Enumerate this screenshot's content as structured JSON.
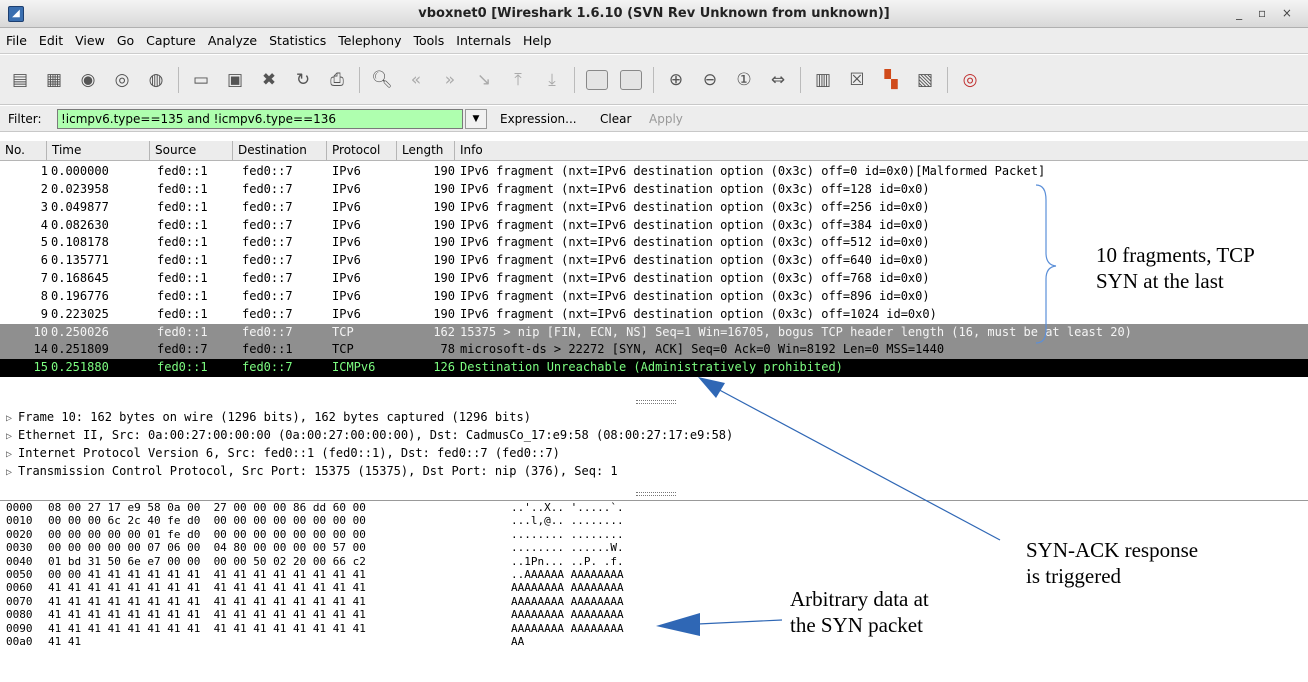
{
  "window": {
    "title": "vboxnet0   [Wireshark 1.6.10  (SVN Rev Unknown from unknown)]",
    "controls": "_ ▫ ×"
  },
  "menu": [
    "File",
    "Edit",
    "View",
    "Go",
    "Capture",
    "Analyze",
    "Statistics",
    "Telephony",
    "Tools",
    "Internals",
    "Help"
  ],
  "filter": {
    "label": "Filter:",
    "value": "!icmpv6.type==135 and !icmpv6.type==136",
    "expression": "Expression...",
    "clear": "Clear",
    "apply": "Apply",
    "valid_color": "#afffaf"
  },
  "columns": [
    "No.",
    "Time",
    "Source",
    "Destination",
    "Protocol",
    "Length",
    "Info"
  ],
  "packets": [
    {
      "no": "1",
      "time": "0.000000",
      "src": "fed0::1",
      "dst": "fed0::7",
      "proto": "IPv6",
      "len": "190",
      "info": "IPv6 fragment (nxt=IPv6 destination option (0x3c) off=0 id=0x0)[Malformed Packet]"
    },
    {
      "no": "2",
      "time": "0.023958",
      "src": "fed0::1",
      "dst": "fed0::7",
      "proto": "IPv6",
      "len": "190",
      "info": "IPv6 fragment (nxt=IPv6 destination option (0x3c) off=128 id=0x0)"
    },
    {
      "no": "3",
      "time": "0.049877",
      "src": "fed0::1",
      "dst": "fed0::7",
      "proto": "IPv6",
      "len": "190",
      "info": "IPv6 fragment (nxt=IPv6 destination option (0x3c) off=256 id=0x0)"
    },
    {
      "no": "4",
      "time": "0.082630",
      "src": "fed0::1",
      "dst": "fed0::7",
      "proto": "IPv6",
      "len": "190",
      "info": "IPv6 fragment (nxt=IPv6 destination option (0x3c) off=384 id=0x0)"
    },
    {
      "no": "5",
      "time": "0.108178",
      "src": "fed0::1",
      "dst": "fed0::7",
      "proto": "IPv6",
      "len": "190",
      "info": "IPv6 fragment (nxt=IPv6 destination option (0x3c) off=512 id=0x0)"
    },
    {
      "no": "6",
      "time": "0.135771",
      "src": "fed0::1",
      "dst": "fed0::7",
      "proto": "IPv6",
      "len": "190",
      "info": "IPv6 fragment (nxt=IPv6 destination option (0x3c) off=640 id=0x0)"
    },
    {
      "no": "7",
      "time": "0.168645",
      "src": "fed0::1",
      "dst": "fed0::7",
      "proto": "IPv6",
      "len": "190",
      "info": "IPv6 fragment (nxt=IPv6 destination option (0x3c) off=768 id=0x0)"
    },
    {
      "no": "8",
      "time": "0.196776",
      "src": "fed0::1",
      "dst": "fed0::7",
      "proto": "IPv6",
      "len": "190",
      "info": "IPv6 fragment (nxt=IPv6 destination option (0x3c) off=896 id=0x0)"
    },
    {
      "no": "9",
      "time": "0.223025",
      "src": "fed0::1",
      "dst": "fed0::7",
      "proto": "IPv6",
      "len": "190",
      "info": "IPv6 fragment (nxt=IPv6 destination option (0x3c) off=1024 id=0x0)"
    },
    {
      "no": "10",
      "time": "0.250026",
      "src": "fed0::1",
      "dst": "fed0::7",
      "proto": "TCP",
      "len": "162",
      "info": "15375 > nip [FIN, ECN, NS] Seq=1 Win=16705, bogus TCP header length (16, must be at least 20)",
      "style": "gray"
    },
    {
      "no": "14",
      "time": "0.251809",
      "src": "fed0::7",
      "dst": "fed0::1",
      "proto": "TCP",
      "len": "78",
      "info": "microsoft-ds > 22272 [SYN, ACK] Seq=0 Ack=0 Win=8192 Len=0 MSS=1440",
      "style": "gray"
    },
    {
      "no": "15",
      "time": "0.251880",
      "src": "fed0::1",
      "dst": "fed0::7",
      "proto": "ICMPv6",
      "len": "126",
      "info": "Destination Unreachable (Administratively prohibited)",
      "style": "selected"
    }
  ],
  "details": [
    "Frame 10: 162 bytes on wire (1296 bits), 162 bytes captured (1296 bits)",
    "Ethernet II, Src: 0a:00:27:00:00:00 (0a:00:27:00:00:00), Dst: CadmusCo_17:e9:58 (08:00:27:17:e9:58)",
    "Internet Protocol Version 6, Src: fed0::1 (fed0::1), Dst: fed0::7 (fed0::7)",
    "Transmission Control Protocol, Src Port: 15375 (15375), Dst Port: nip (376), Seq: 1"
  ],
  "hex": [
    {
      "off": "0000",
      "bytes": "08 00 27 17 e9 58 0a 00  27 00 00 00 86 dd 60 00",
      "ascii": "..'..X.. '.....`."
    },
    {
      "off": "0010",
      "bytes": "00 00 00 6c 2c 40 fe d0  00 00 00 00 00 00 00 00",
      "ascii": "...l,@.. ........"
    },
    {
      "off": "0020",
      "bytes": "00 00 00 00 00 01 fe d0  00 00 00 00 00 00 00 00",
      "ascii": "........ ........"
    },
    {
      "off": "0030",
      "bytes": "00 00 00 00 00 07 06 00  04 80 00 00 00 00 57 00",
      "ascii": "........ ......W."
    },
    {
      "off": "0040",
      "bytes": "01 bd 31 50 6e e7 00 00  00 00 50 02 20 00 66 c2",
      "ascii": "..1Pn... ..P. .f."
    },
    {
      "off": "0050",
      "bytes": "00 00 41 41 41 41 41 41  41 41 41 41 41 41 41 41",
      "ascii": "..AAAAAA AAAAAAAA"
    },
    {
      "off": "0060",
      "bytes": "41 41 41 41 41 41 41 41  41 41 41 41 41 41 41 41",
      "ascii": "AAAAAAAA AAAAAAAA"
    },
    {
      "off": "0070",
      "bytes": "41 41 41 41 41 41 41 41  41 41 41 41 41 41 41 41",
      "ascii": "AAAAAAAA AAAAAAAA"
    },
    {
      "off": "0080",
      "bytes": "41 41 41 41 41 41 41 41  41 41 41 41 41 41 41 41",
      "ascii": "AAAAAAAA AAAAAAAA"
    },
    {
      "off": "0090",
      "bytes": "41 41 41 41 41 41 41 41  41 41 41 41 41 41 41 41",
      "ascii": "AAAAAAAA AAAAAAAA"
    },
    {
      "off": "00a0",
      "bytes": "41 41",
      "ascii": "AA"
    }
  ],
  "annotations": {
    "fragments": [
      "10 fragments, TCP",
      "SYN at the last"
    ],
    "synack": [
      "SYN-ACK response",
      "is triggered"
    ],
    "arbitrary": [
      "Arbitrary data at",
      "the SYN packet"
    ]
  }
}
